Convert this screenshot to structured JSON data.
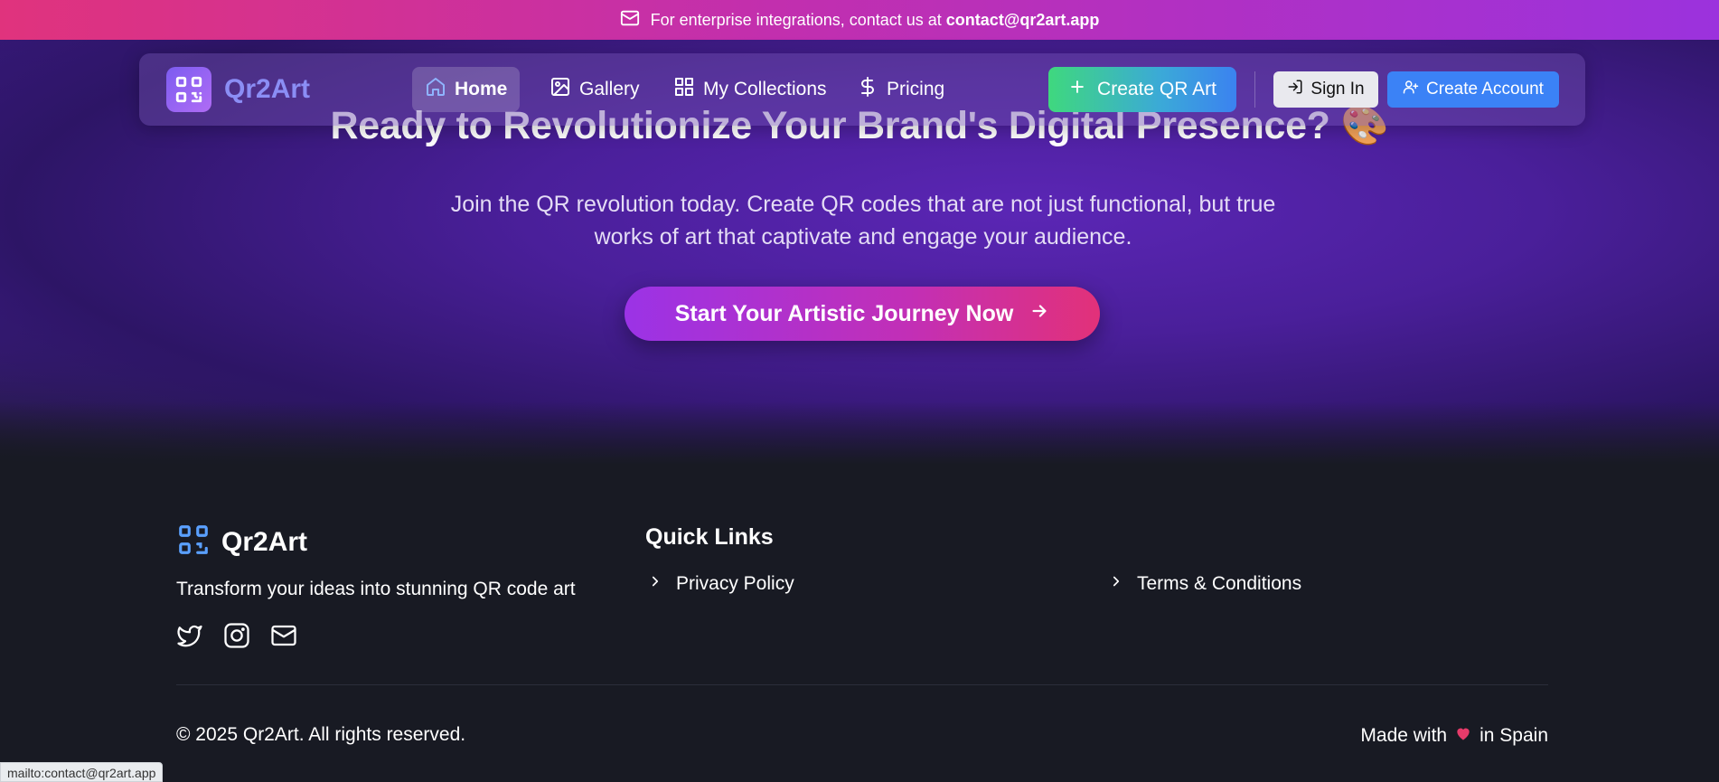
{
  "banner": {
    "text": "For enterprise integrations, contact us at",
    "email": "contact@qr2art.app",
    "icon": "mail-icon"
  },
  "navbar": {
    "brand": "Qr2Art",
    "items": [
      {
        "label": "Home",
        "icon": "home-icon",
        "active": true
      },
      {
        "label": "Gallery",
        "icon": "image-icon"
      },
      {
        "label": "My Collections",
        "icon": "grid-icon"
      },
      {
        "label": "Pricing",
        "icon": "dollar-icon"
      }
    ],
    "create_qr": "Create QR Art",
    "sign_in": "Sign In",
    "create_account": "Create Account"
  },
  "hero": {
    "title": "Ready to Revolutionize Your Brand's Digital Presence? 🎨",
    "subtitle": "Join the QR revolution today. Create QR codes that are not just functional, but true works of art that captivate and engage your audience.",
    "cta": "Start Your Artistic Journey Now"
  },
  "footer": {
    "brand": "Qr2Art",
    "tagline": "Transform your ideas into stunning QR code art",
    "quick_links_heading": "Quick Links",
    "links": [
      "Privacy Policy",
      "Terms & Conditions"
    ],
    "copyright": "© 2025 Qr2Art. All rights reserved.",
    "made_prefix": "Made with",
    "made_suffix": "in Spain"
  },
  "status_bar": "mailto:contact@qr2art.app",
  "colors": {
    "accent_blue": "#3b82f6",
    "heart": "#e63b6a",
    "footer_bg": "#181a23"
  }
}
